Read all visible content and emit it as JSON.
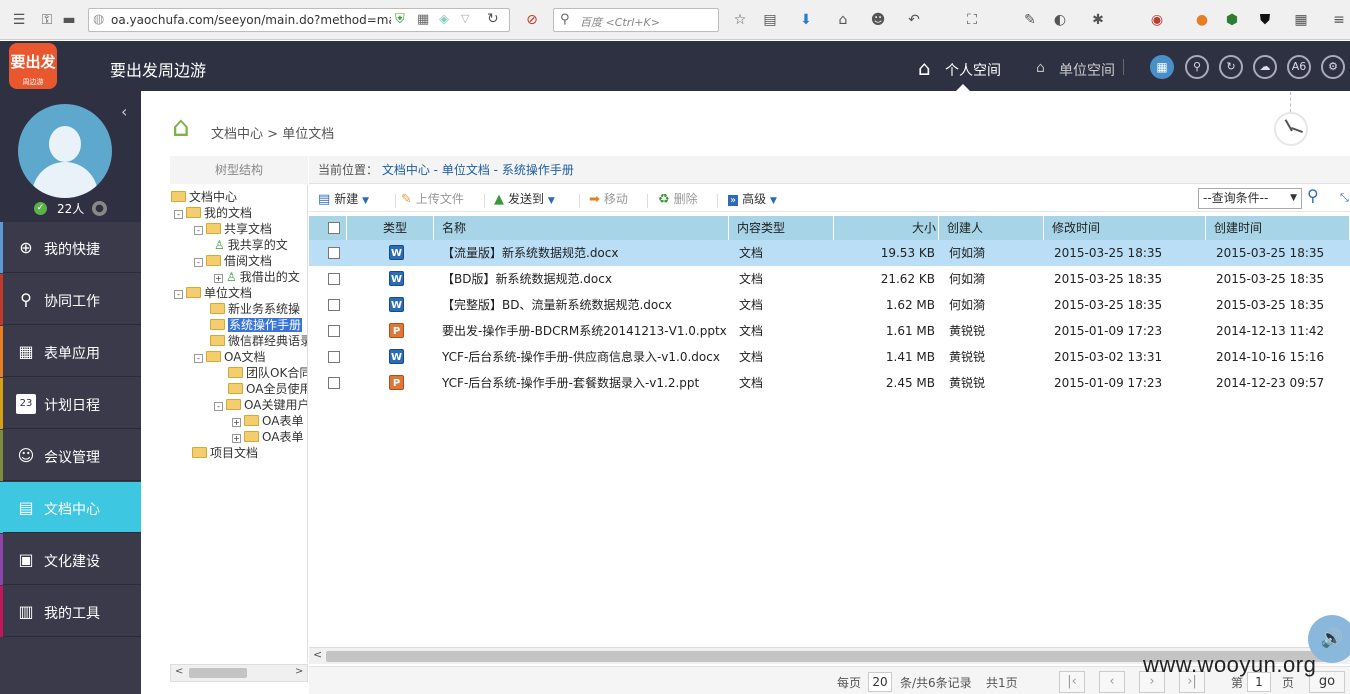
{
  "browser": {
    "url": "oa.yaochufa.com/seeyon/main.do?method=mai",
    "search_placeholder": "百度 <Ctrl+K>"
  },
  "app": {
    "logo_text": "要出发",
    "logo_sub": "周边游",
    "title": "要出发周边游",
    "nav_personal": "个人空间",
    "nav_unit": "单位空间",
    "a6": "A6"
  },
  "profile": {
    "people": "22人"
  },
  "sidebar": {
    "items": [
      {
        "label": "我的快捷",
        "icon": "⊕",
        "color": "#5b9bd5"
      },
      {
        "label": "协同工作",
        "icon": "⚲",
        "color": "#c0392b"
      },
      {
        "label": "表单应用",
        "icon": "▦",
        "color": "#e67e22"
      },
      {
        "label": "计划日程",
        "icon": "23",
        "color": "#d4a017"
      },
      {
        "label": "会议管理",
        "icon": "☺",
        "color": "#7f8c3d"
      },
      {
        "label": "文档中心",
        "icon": "▤",
        "color": "#3ec7e0"
      },
      {
        "label": "文化建设",
        "icon": "▣",
        "color": "#8e44ad"
      },
      {
        "label": "我的工具",
        "icon": "▥",
        "color": "#c2185b"
      }
    ]
  },
  "breadcrumb": {
    "root": "文档中心",
    "sep": ">",
    "current": "单位文档"
  },
  "tree": {
    "header": "树型结构",
    "nodes": [
      {
        "label": "文档中心"
      },
      {
        "label": "我的文档"
      },
      {
        "label": "共享文档"
      },
      {
        "label": "我共享的文"
      },
      {
        "label": "借阅文档"
      },
      {
        "label": "我借出的文"
      },
      {
        "label": "单位文档"
      },
      {
        "label": "新业务系统操"
      },
      {
        "label": "系统操作手册"
      },
      {
        "label": "微信群经典语录"
      },
      {
        "label": "OA文档"
      },
      {
        "label": "团队OK合同"
      },
      {
        "label": "OA全员使用"
      },
      {
        "label": "OA关键用户"
      },
      {
        "label": "OA表单"
      },
      {
        "label": "OA表单"
      },
      {
        "label": "项目文档"
      }
    ]
  },
  "location": {
    "prefix": "当前位置：",
    "path1": "文档中心",
    "path2": "单位文档",
    "path3": "系统操作手册",
    "sep": " - "
  },
  "toolbar": {
    "new": "新建",
    "upload": "上传文件",
    "sendto": "发送到",
    "move": "移动",
    "delete": "删除",
    "advanced": "高级",
    "query_placeholder": "--查询条件--"
  },
  "table": {
    "headers": [
      "类型",
      "名称",
      "内容类型",
      "大小",
      "创建人",
      "修改时间",
      "创建时间"
    ],
    "rows": [
      {
        "type": "word",
        "name": "【流量版】新系统数据规范.docx",
        "ctype": "文档",
        "size": "19.53 KB",
        "creator": "何如漪",
        "modified": "2015-03-25 18:35",
        "created": "2015-03-25 18:35"
      },
      {
        "type": "word",
        "name": "【BD版】新系统数据规范.docx",
        "ctype": "文档",
        "size": "21.62 KB",
        "creator": "何如漪",
        "modified": "2015-03-25 18:35",
        "created": "2015-03-25 18:35"
      },
      {
        "type": "word",
        "name": "【完整版】BD、流量新系统数据规范.docx",
        "ctype": "文档",
        "size": "1.62 MB",
        "creator": "何如漪",
        "modified": "2015-03-25 18:35",
        "created": "2015-03-25 18:35"
      },
      {
        "type": "ppt",
        "name": "要出发-操作手册-BDCRM系统20141213-V1.0.pptx",
        "ctype": "文档",
        "size": "1.61 MB",
        "creator": "黄锐锐",
        "modified": "2015-01-09 17:23",
        "created": "2014-12-13 11:42"
      },
      {
        "type": "word",
        "name": "YCF-后台系统-操作手册-供应商信息录入-v1.0.docx",
        "ctype": "文档",
        "size": "1.41 MB",
        "creator": "黄锐锐",
        "modified": "2015-03-02 13:31",
        "created": "2014-10-16 15:16"
      },
      {
        "type": "ppt",
        "name": "YCF-后台系统-操作手册-套餐数据录入-v1.2.ppt",
        "ctype": "文档",
        "size": "2.45 MB",
        "creator": "黄锐锐",
        "modified": "2015-01-09 17:23",
        "created": "2014-12-23 09:57"
      }
    ]
  },
  "pager": {
    "per_page_label": "每页",
    "per_page": "20",
    "records": "条/共6条记录",
    "pages": "共1页",
    "page_label": "第",
    "page": "1",
    "page_suffix": "页",
    "go": "go"
  },
  "watermark": "www.wooyun.org"
}
